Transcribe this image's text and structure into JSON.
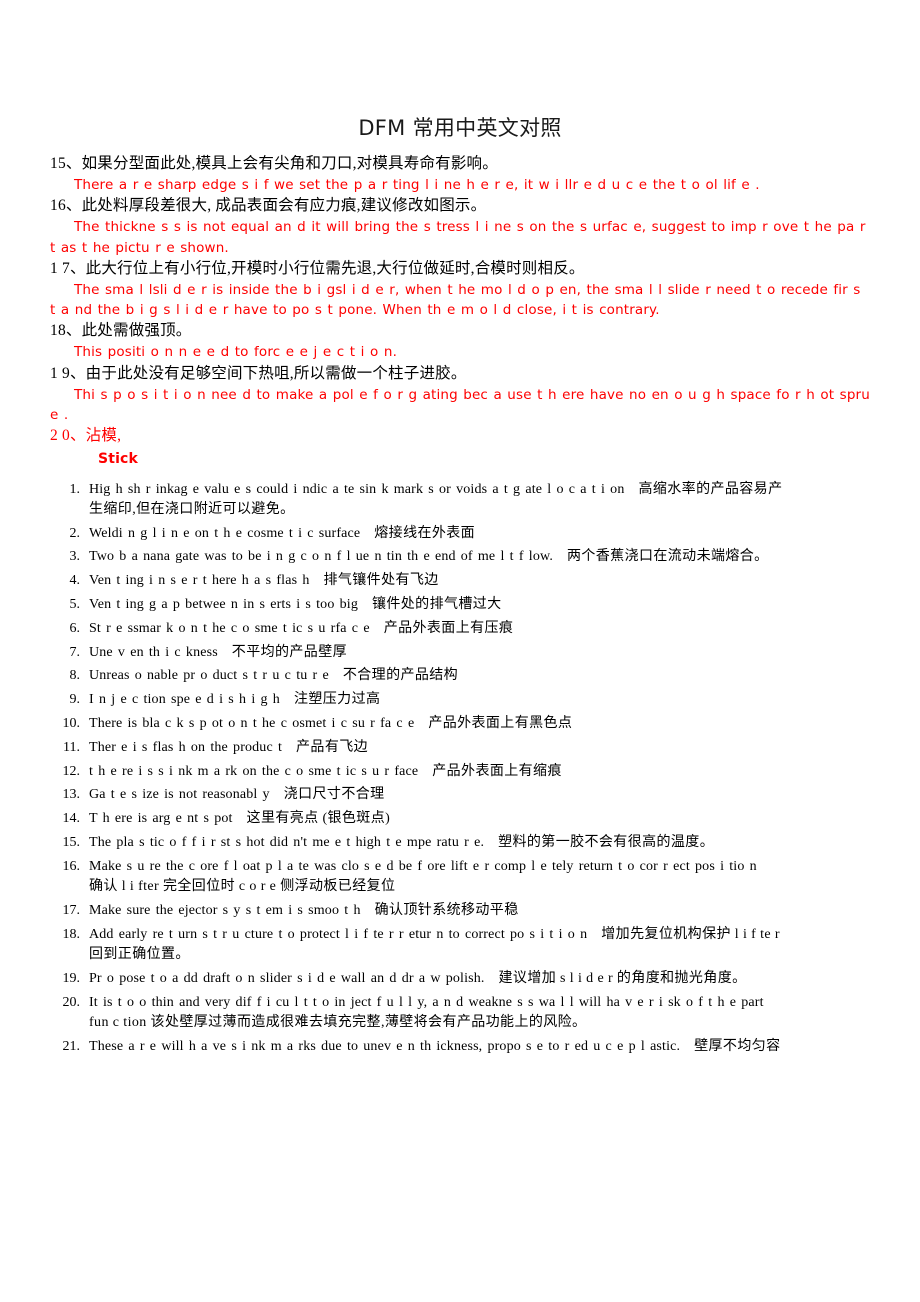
{
  "document": {
    "title": "DFM 常用中英文对照",
    "colors": {
      "red": "#fe0000",
      "black": "#000000",
      "background": "#ffffff"
    }
  },
  "notes": [
    {
      "cn": "15、如果分型面此处,模具上会有尖角和刀口,对模具寿命有影响。",
      "en": "There   a r e   sharp edge s   i f we set the p a r ting   l i ne   h e r e,  it  w i llr e d u c e  the t o ol lif e ."
    },
    {
      "cn": "16、此处料厚段差很大, 成品表面会有应力痕,建议修改如图示。",
      "en": "The thickne s s  is  not equal an d it will bring the  s tress l i ne s  on  the  s urfac e, suggest to imp r ove  t he pa r t  as   t he   pictu r e   shown."
    },
    {
      "cn": "1 7、此大行位上有小行位,开模时小行位需先退,大行位做延时,合模时则相反。",
      "en": "The sma l lsli d e r  is  inside the  b i gsl i d e r,  when  t he mo l d o p en, the  sma l l slide r  need  t o recede  fir s t  a nd the   b i g s l i d e r  have to po s t pone. When th e  m o l d close, i t  is  contrary."
    },
    {
      "cn": "18、此处需做强顶。",
      "en": "This positi o n  n e e d  to  forc e  e j e c t i o n."
    },
    {
      "cn": "1 9、由于此处没有足够空间下热咀,所以需做一个柱子进胶。",
      "en": "Thi s    p o s i t i o n nee d  to make a pol e  f o r  g ating bec a use t h ere have no en o u g h  space fo r  h ot  spru e ."
    },
    {
      "cn": "2 0、沾模,",
      "cn_red": true,
      "en": "Stick",
      "en_bold": true
    }
  ],
  "list_items": [
    {
      "num": "1.",
      "en": "Hig h  sh r inkag e    valu e s could  i ndic a te  sin k  mark s  or voids  a t   g ate l o c a t i on",
      "cn": "高缩水率的产品容易产",
      "cn_wrap": "生缩印,但在浇口附近可以避免。"
    },
    {
      "num": "2.",
      "en": "Weldi n g l i n e on  t h e  cosme t i c   surface",
      "cn": "熔接线在外表面"
    },
    {
      "num": "3.",
      "en": "Two   b a nana  gate  was to be i n g  c o n f l ue n tin th e end of  me l t    f low.",
      "cn": "两个香蕉浇口在流动未端熔合。"
    },
    {
      "num": "4.",
      "en": "Ven t ing  i n s e r t  here  h a s  flas h",
      "cn": "排气镶件处有飞边"
    },
    {
      "num": "5.",
      "en": "Ven t ing  g a p  betwee n  in s erts  i s  too big",
      "cn": "镶件处的排气槽过大"
    },
    {
      "num": "6.",
      "en": "St r e ssmar k  o n  t he  c o sme t ic  s u rfa c e",
      "cn": "产品外表面上有压痕"
    },
    {
      "num": "7.",
      "en": "Une v en th i c kness",
      "cn": "不平均的产品壁厚"
    },
    {
      "num": "8.",
      "en": "Unreas o nable pr o duct s t r u c tu r e",
      "cn": "不合理的产品结构"
    },
    {
      "num": "9.",
      "en": "I n j e c tion spe e d  i s h i g h",
      "cn": "注塑压力过高"
    },
    {
      "num": "10.",
      "en": "There is bla c k s p ot  o n  t he   c osmet i c  su r fa c e",
      "cn": "产品外表面上有黑色点"
    },
    {
      "num": "11.",
      "en": "Ther e  i s   flas h  on the produc t",
      "cn": "产品有飞边"
    },
    {
      "num": "12.",
      "en": "t h e re i s   s i nk  m a rk on the c o sme t ic  s u r face",
      "cn": "产品外表面上有缩痕"
    },
    {
      "num": "13.",
      "en": "Ga t e   s ize is  not  reasonabl y",
      "cn": "浇口尺寸不合理"
    },
    {
      "num": "14.",
      "en": "T h ere is arg e nt   s pot",
      "cn": "这里有亮点 (银色斑点)"
    },
    {
      "num": "15.",
      "en": "The   pla s tic  o f f i r st  s hot did n't  me e t  high t e mpe ratu r e.",
      "cn": "塑料的第一胶不会有很高的温度。",
      "cn_inline": true
    },
    {
      "num": "16.",
      "en": "Make   s u re the   c ore   f l oat  p l a te was  clo s e d  be f ore lift e r   comp l e tely return  t o cor r ect pos i tio n",
      "cn_wrap": "确认 l i fter 完全回位时 c o r e 侧浮动板已经复位"
    },
    {
      "num": "17.",
      "en": "Make   sure  the ejector  s y s t em i s  smoo t h",
      "cn": "确认顶针系统移动平稳"
    },
    {
      "num": "18.",
      "en": "Add early re t urn  s t r u cture  t o protect  l i f te r  r etur n  to correct po s i t i o n",
      "cn": "增加先复位机构保护 l i f te r",
      "cn_wrap": "回到正确位置。"
    },
    {
      "num": "19.",
      "en": "Pr o pose t o   a dd draft o n  slider s i d e   wall an d  dr a w polish.",
      "cn": "建议增加 s l i d e r 的角度和抛光角度。",
      "cn_inline": true
    },
    {
      "num": "20.",
      "en": "It is t o o thin and very dif f i cu l t   t o in ject  f u l l y,  a n d weakne s s  wa l l   will ha v e  r i sk o f   t h e   part",
      "cn_wrap": "fun c tion   该处壁厚过薄而造成很难去填充完整,薄壁将会有产品功能上的风险。"
    },
    {
      "num": "21.",
      "en": "These   a r e  will  h a ve  s i nk m a rks due  to unev e n  th ickness, propo s e  to  r ed u c e p l astic.",
      "cn": "壁厚不均匀容"
    }
  ]
}
